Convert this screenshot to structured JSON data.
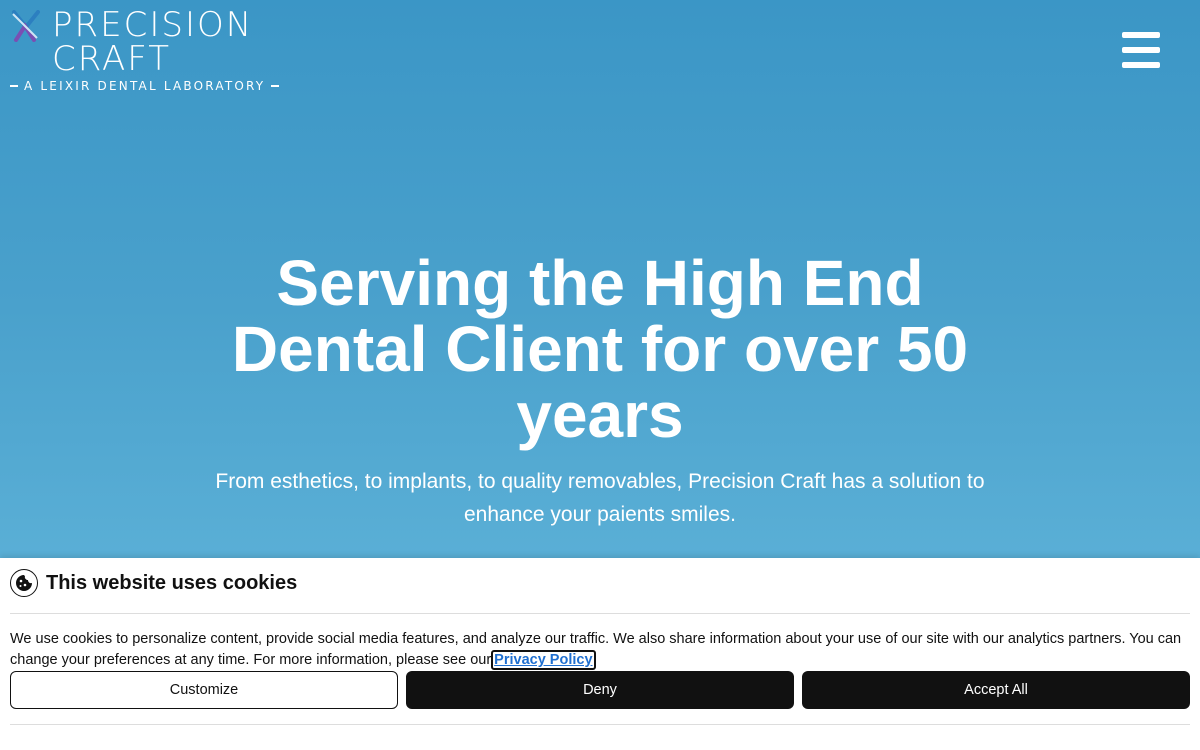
{
  "brand": {
    "name_line1": "PRECISION",
    "name_line2": "CRAFT",
    "tagline": "A LEIXIR DENTAL LABORATORY",
    "colors": {
      "hero": "#4aa1cc",
      "mark_blue": "#2c7fc0",
      "mark_purple": "#7a4fb3"
    }
  },
  "header": {
    "menu_icon": "hamburger-menu-icon"
  },
  "hero": {
    "title": "Serving the High End Dental Client for over 50 years",
    "subtitle": "From esthetics, to implants, to quality removables, Precision Craft has a solution to enhance your paients smiles."
  },
  "cookie_banner": {
    "icon": "cookie-icon",
    "title": "This website uses cookies",
    "text": "We use cookies to personalize content, provide social media features, and analyze our traffic. We also share information about your use of our site with our analytics partners. You can change your preferences at any time. For more information, please see our",
    "privacy_link": "Privacy Policy",
    "customize_label": "Customize",
    "deny_label": "Deny",
    "accept_label": "Accept All"
  }
}
